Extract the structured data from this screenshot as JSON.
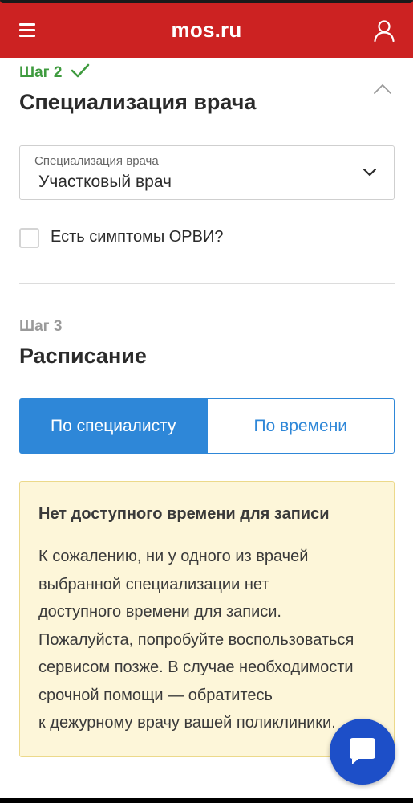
{
  "header": {
    "logo": "mos.ru",
    "menu_icon": "hamburger-menu-icon",
    "user_icon": "user-profile-icon",
    "brand_color": "#cc2222"
  },
  "step2": {
    "label": "Шаг 2",
    "status_icon": "checkmark-icon",
    "title": "Специализация врача",
    "collapse_icon": "chevron-up-icon",
    "select": {
      "label": "Специализация врача",
      "value": "Участковый врач"
    },
    "checkbox": {
      "label": "Есть симптомы ОРВИ?",
      "checked": false
    }
  },
  "step3": {
    "label": "Шаг 3",
    "title": "Расписание",
    "tabs": [
      {
        "label": "По специалисту",
        "active": true
      },
      {
        "label": "По времени",
        "active": false
      }
    ]
  },
  "notice": {
    "title": "Нет доступного времени для записи",
    "body": "К сожалению, ни у одного из врачей\nвыбранной специализации нет\nдоступного времени для записи.\nПожалуйста, попробуйте воспользоваться\nсервисом позже. В случае необходимости\nсрочной помощи — обратитесь\nк дежурному врачу вашей поликлиники."
  },
  "chat": {
    "icon": "chat-bubble-icon",
    "accent": "#1d4fc8"
  },
  "colors": {
    "success": "#3f9b3f",
    "primary": "#2e87d8",
    "notice_bg": "#fdf6d9"
  }
}
